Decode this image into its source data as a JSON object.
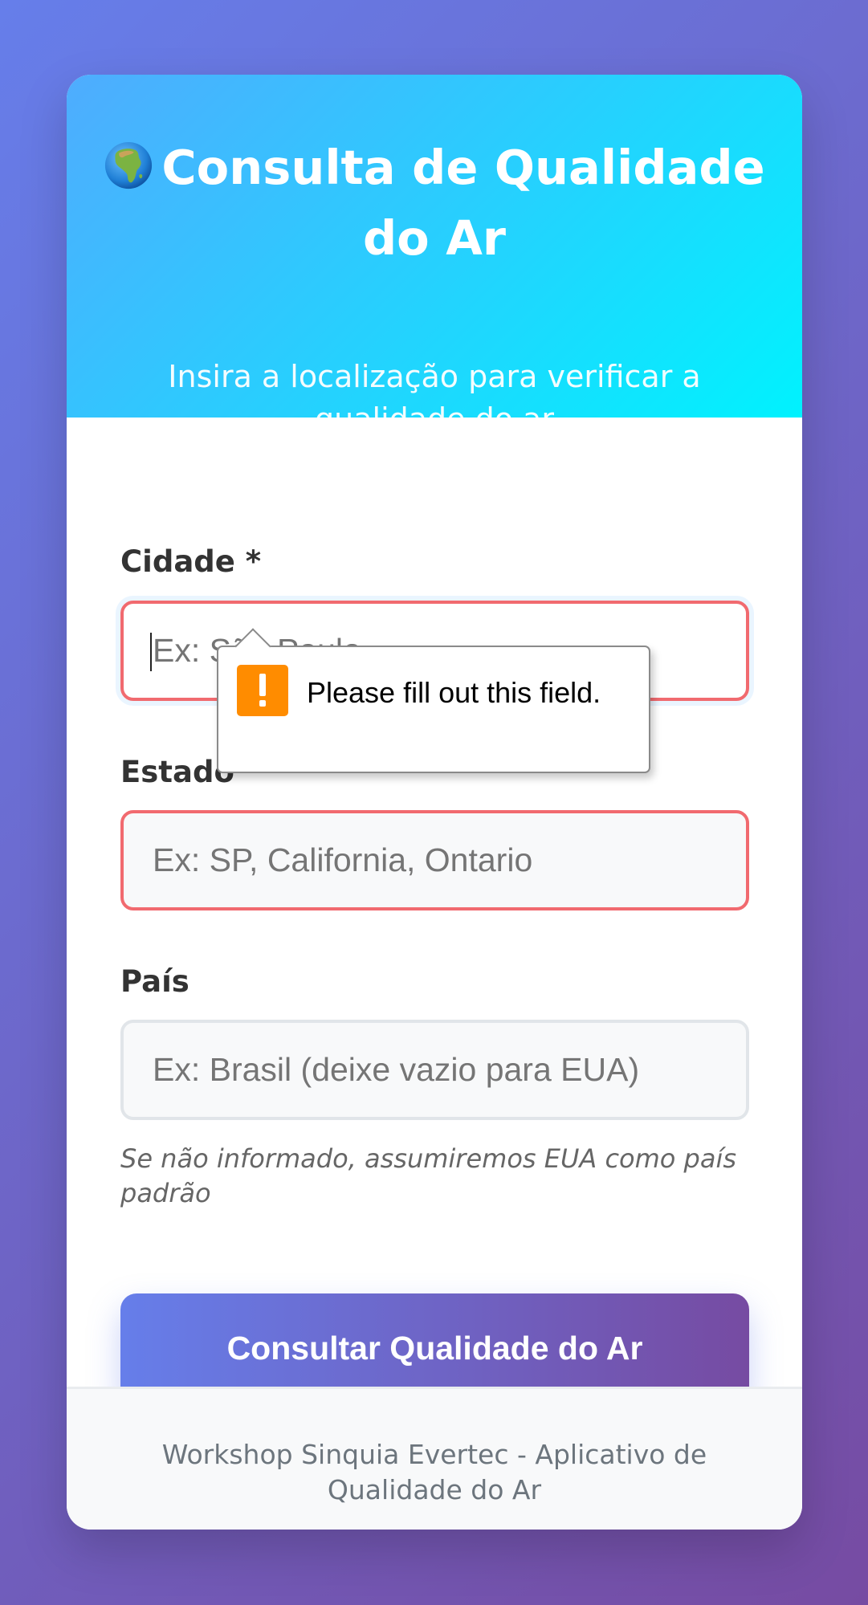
{
  "header": {
    "icon": "globe-africa-icon",
    "title": "Consulta de Qualidade do Ar",
    "subtitle": "Insira a localização para verificar a qualidade do ar"
  },
  "form": {
    "city": {
      "label": "Cidade *",
      "value": "",
      "placeholder": "Ex: São Paulo"
    },
    "state": {
      "label": "Estado",
      "value": "",
      "placeholder": "Ex: SP, California, Ontario"
    },
    "country": {
      "label": "País",
      "value": "",
      "placeholder": "Ex: Brasil (deixe vazio para EUA)",
      "hint": "Se não informado, assumiremos EUA como país padrão"
    },
    "submit_label": "Consultar Qualidade do Ar"
  },
  "validation_tooltip": {
    "icon": "warning-icon",
    "message": "Please fill out this field."
  },
  "footer": {
    "text": "Workshop Sinquia Evertec - Aplicativo de Qualidade do Ar"
  },
  "colors": {
    "page_gradient": [
      "#667eea",
      "#764ba2"
    ],
    "header_gradient": [
      "#4facfe",
      "#00f2fe"
    ],
    "invalid_border": "#f16a6f",
    "warning": "#ff8c00"
  }
}
